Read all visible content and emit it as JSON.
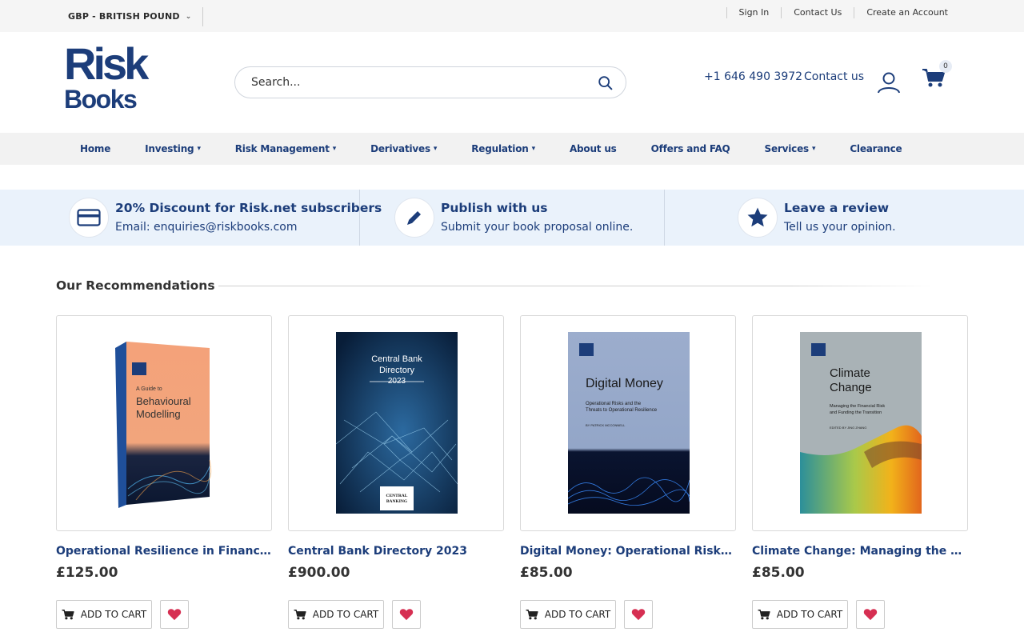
{
  "topbar": {
    "currency": "GBP - BRITISH POUND",
    "links": [
      "Sign In",
      "Contact Us",
      "Create an Account"
    ]
  },
  "header": {
    "logo_line1": "Risk",
    "logo_line2": "Books",
    "search_placeholder": "Search...",
    "phone": "+1 646 490 3972",
    "contact": "Contact us",
    "cart_count": "0"
  },
  "nav": {
    "items": [
      {
        "label": "Home",
        "dropdown": false
      },
      {
        "label": "Investing",
        "dropdown": true
      },
      {
        "label": "Risk Management",
        "dropdown": true
      },
      {
        "label": "Derivatives",
        "dropdown": true
      },
      {
        "label": "Regulation",
        "dropdown": true
      },
      {
        "label": "About us",
        "dropdown": false
      },
      {
        "label": "Offers and FAQ",
        "dropdown": false
      },
      {
        "label": "Services",
        "dropdown": true
      },
      {
        "label": "Clearance",
        "dropdown": false
      }
    ]
  },
  "promo": {
    "items": [
      {
        "title": "20% Discount for Risk.net subscribers",
        "sub": "Email: enquiries@riskbooks.com",
        "icon": "credit-card-icon"
      },
      {
        "title": "Publish with us",
        "sub": "Submit your book proposal online.",
        "icon": "pencil-icon"
      },
      {
        "title": "Leave a review",
        "sub": "Tell us your opinion.",
        "icon": "star-icon"
      }
    ]
  },
  "recommendations": {
    "heading": "Our Recommendations",
    "add_to_cart_label": "ADD TO CART",
    "products": [
      {
        "title": "Operational Resilience in Financial I...",
        "price": "£125.00",
        "cover_lines": [
          "A Guide to",
          "Behavioural",
          "Modelling"
        ],
        "cover_color": "#f2a57c"
      },
      {
        "title": "Central Bank Directory 2023",
        "price": "£900.00",
        "cover_lines": [
          "Central Bank",
          "Directory",
          "2023",
          "CENTRAL",
          "BANKING"
        ],
        "cover_color": "#0c2a4f"
      },
      {
        "title": "Digital Money: Operational Risks an...",
        "price": "£85.00",
        "cover_lines": [
          "Digital Money",
          "Operational Risks and the",
          "Threats to Operational Resilience",
          "BY PATRICK MCCONNELL"
        ],
        "cover_color": "#98aacb"
      },
      {
        "title": "Climate Change: Managing the Fina...",
        "price": "£85.00",
        "cover_lines": [
          "Climate",
          "Change",
          "Managing the Financial Risk",
          "and Funding the Transition",
          "EDITED BY JING ZHANG"
        ],
        "cover_color": "#a9b2b6"
      }
    ]
  }
}
